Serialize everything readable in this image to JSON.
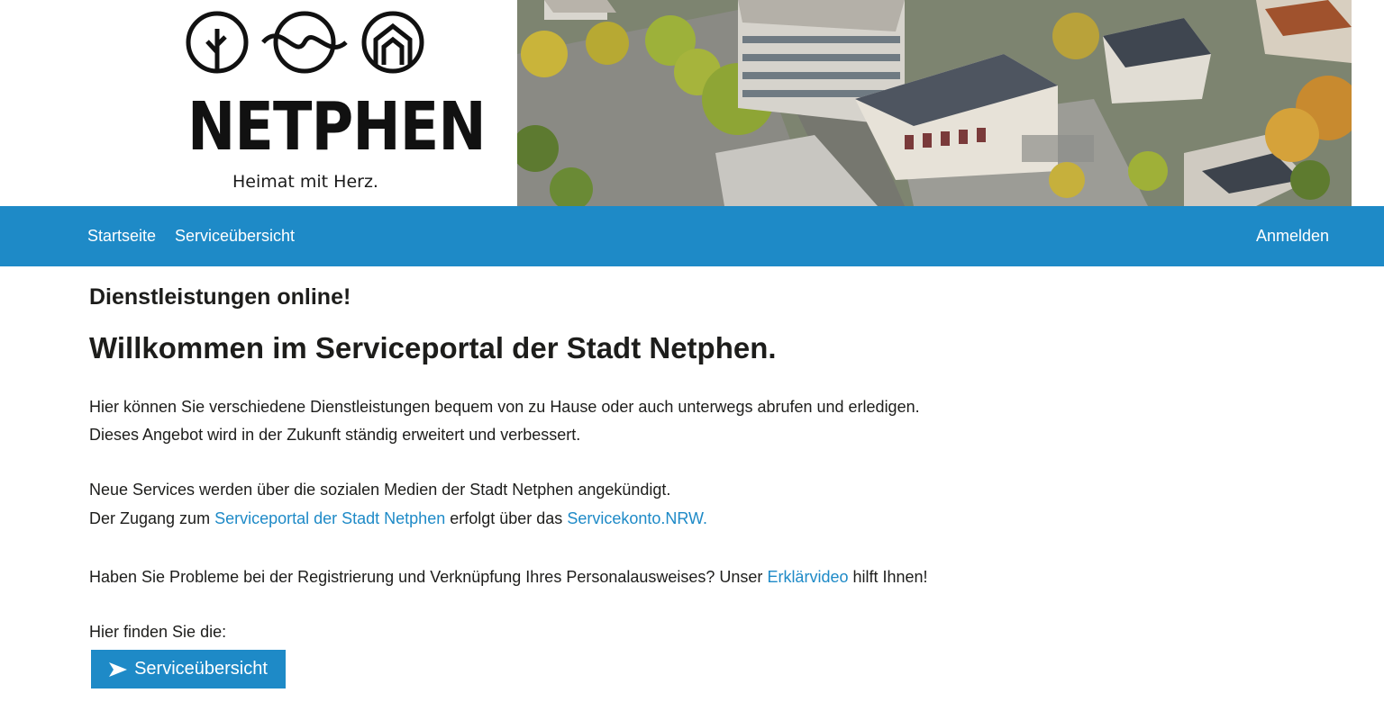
{
  "header": {
    "logo_text": "NETPHEN",
    "slogan": "Heimat mit Herz."
  },
  "nav": {
    "items": [
      {
        "label": "Startseite"
      },
      {
        "label": "Serviceübersicht"
      }
    ],
    "login_label": "Anmelden"
  },
  "main": {
    "subtitle": "Dienstleistungen online!",
    "title": "Willkommen im Serviceportal der Stadt Netphen.",
    "p1_line1": "Hier können Sie verschiedene Dienstleistungen bequem von zu Hause oder auch unterwegs abrufen und erledigen.",
    "p1_line2": "Dieses Angebot wird in der Zukunft ständig erweitert und verbessert.",
    "p2_line1": "Neue Services werden über die sozialen Medien der Stadt Netphen angekündigt.",
    "p2_line2_before": "Der Zugang zum ",
    "p2_link1": "Serviceportal der Stadt Netphen",
    "p2_line2_middle": " erfolgt über das ",
    "p2_link2": "Servicekonto.NRW.",
    "p3_before": "Haben Sie Probleme bei der Registrierung und Verknüpfung Ihres Personalausweises? Unser ",
    "p3_link": "Erklärvideo",
    "p3_after": " hilft Ihnen!",
    "p4": "Hier finden Sie die:",
    "button_label": "Serviceübersicht"
  },
  "colors": {
    "accent": "#1e8ac7",
    "text": "#1d1d1b",
    "background": "#ffffff"
  },
  "icons": {
    "logo_icons": [
      "tree-icon",
      "wave-icon",
      "house-icon"
    ],
    "button_icon": "arrow-right-icon"
  }
}
